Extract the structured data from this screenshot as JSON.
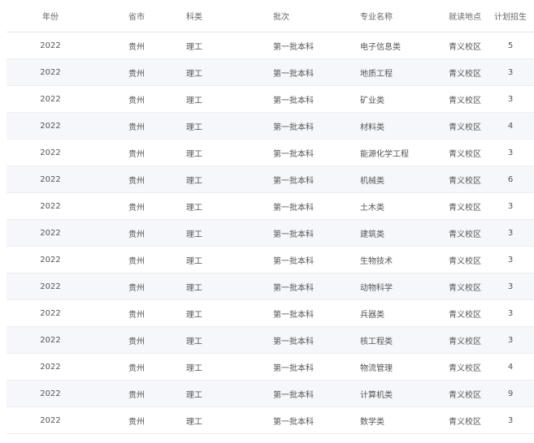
{
  "table": {
    "headers": {
      "year": "年份",
      "province": "省市",
      "category": "科类",
      "batch": "批次",
      "major": "专业名称",
      "location": "就读地点",
      "plan": "计划招生"
    },
    "rows": [
      {
        "year": "2022",
        "province": "贵州",
        "category": "理工",
        "batch": "第一批本科",
        "major": "电子信息类",
        "location": "青义校区",
        "plan": "5"
      },
      {
        "year": "2022",
        "province": "贵州",
        "category": "理工",
        "batch": "第一批本科",
        "major": "地质工程",
        "location": "青义校区",
        "plan": "3"
      },
      {
        "year": "2022",
        "province": "贵州",
        "category": "理工",
        "batch": "第一批本科",
        "major": "矿业类",
        "location": "青义校区",
        "plan": "3"
      },
      {
        "year": "2022",
        "province": "贵州",
        "category": "理工",
        "batch": "第一批本科",
        "major": "材料类",
        "location": "青义校区",
        "plan": "4"
      },
      {
        "year": "2022",
        "province": "贵州",
        "category": "理工",
        "batch": "第一批本科",
        "major": "能源化学工程",
        "location": "青义校区",
        "plan": "3"
      },
      {
        "year": "2022",
        "province": "贵州",
        "category": "理工",
        "batch": "第一批本科",
        "major": "机械类",
        "location": "青义校区",
        "plan": "6"
      },
      {
        "year": "2022",
        "province": "贵州",
        "category": "理工",
        "batch": "第一批本科",
        "major": "土木类",
        "location": "青义校区",
        "plan": "3"
      },
      {
        "year": "2022",
        "province": "贵州",
        "category": "理工",
        "batch": "第一批本科",
        "major": "建筑类",
        "location": "青义校区",
        "plan": "3"
      },
      {
        "year": "2022",
        "province": "贵州",
        "category": "理工",
        "batch": "第一批本科",
        "major": "生物技术",
        "location": "青义校区",
        "plan": "3"
      },
      {
        "year": "2022",
        "province": "贵州",
        "category": "理工",
        "batch": "第一批本科",
        "major": "动物科学",
        "location": "青义校区",
        "plan": "3"
      },
      {
        "year": "2022",
        "province": "贵州",
        "category": "理工",
        "batch": "第一批本科",
        "major": "兵器类",
        "location": "青义校区",
        "plan": "3"
      },
      {
        "year": "2022",
        "province": "贵州",
        "category": "理工",
        "batch": "第一批本科",
        "major": "核工程类",
        "location": "青义校区",
        "plan": "3"
      },
      {
        "year": "2022",
        "province": "贵州",
        "category": "理工",
        "batch": "第一批本科",
        "major": "物流管理",
        "location": "青义校区",
        "plan": "4"
      },
      {
        "year": "2022",
        "province": "贵州",
        "category": "理工",
        "batch": "第一批本科",
        "major": "计算机类",
        "location": "青义校区",
        "plan": "9"
      },
      {
        "year": "2022",
        "province": "贵州",
        "category": "理工",
        "batch": "第一批本科",
        "major": "数学类",
        "location": "青义校区",
        "plan": "3"
      }
    ]
  }
}
